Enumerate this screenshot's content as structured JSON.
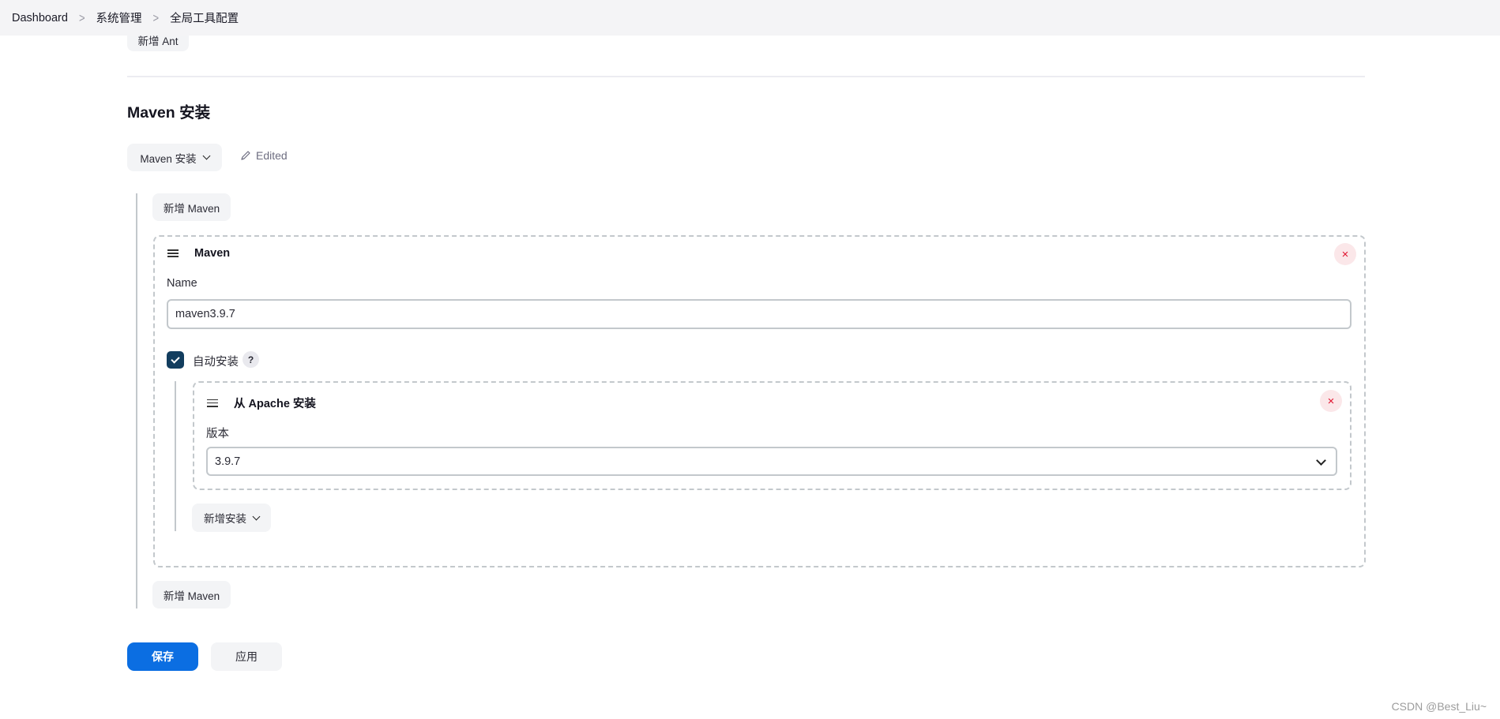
{
  "breadcrumb": [
    "Dashboard",
    "系统管理",
    "全局工具配置"
  ],
  "add_ant_label": "新增 Ant",
  "section": {
    "title": "Maven 安装",
    "dropdown_label": "Maven 安装",
    "edited_label": "Edited"
  },
  "add_maven_label": "新增 Maven",
  "maven_card": {
    "title": "Maven",
    "name_label": "Name",
    "name_value": "maven3.9.7",
    "auto_install_label": "自动安装",
    "auto_install_checked": true,
    "help_label": "?",
    "installer": {
      "title": "从 Apache 安装",
      "version_label": "版本",
      "version_value": "3.9.7"
    },
    "add_installer_label": "新增安装"
  },
  "actions": {
    "save_label": "保存",
    "apply_label": "应用"
  },
  "icons": {
    "close": "×",
    "breadcrumb_sep": ">"
  },
  "colors": {
    "primary": "#0b6ee2",
    "checkbox": "#123d5e",
    "danger": "#e0132f"
  },
  "watermark": "CSDN @Best_Liu~"
}
